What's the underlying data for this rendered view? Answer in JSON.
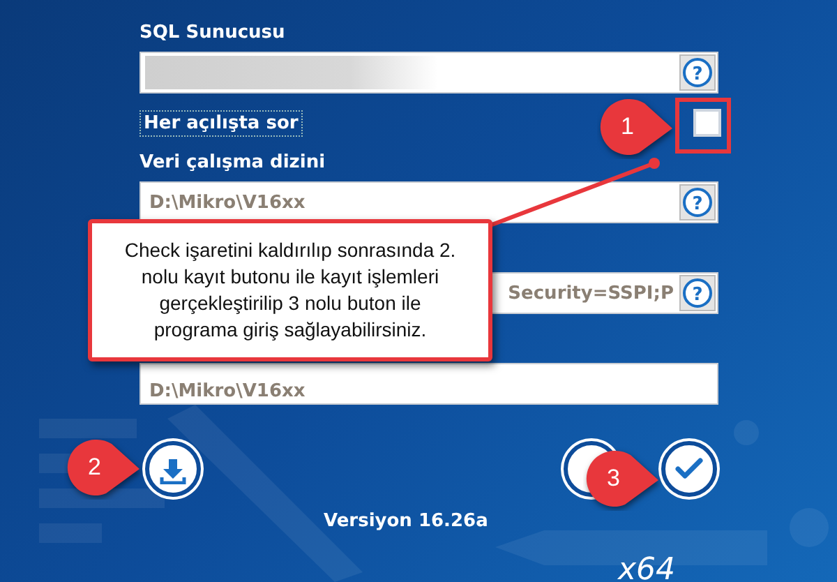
{
  "form": [
    {
      "kind": "label",
      "text": "SQL Sunucusu"
    },
    {
      "kind": "field",
      "masked": true,
      "help": "?"
    },
    {
      "kind": "checkbox",
      "label": "Her açılışta sor",
      "checked": false,
      "focused": true
    },
    {
      "kind": "label",
      "text": "Veri çalışma dizini"
    },
    {
      "kind": "field",
      "value": "D:\\Mikro\\V16xx",
      "help": "?"
    },
    {
      "kind": "field",
      "value": "Security=SSPI;P",
      "help": "?",
      "clipped_start": true
    },
    {
      "kind": "field",
      "value": "D:\\Mikro\\V16xx",
      "clipped_start": true
    }
  ],
  "buttons": [
    {
      "kind": "download"
    },
    {
      "kind": "blank"
    },
    {
      "kind": "confirm"
    }
  ],
  "version": "Versiyon 16.26a",
  "platform": "x64",
  "annotation": {
    "text": "Check işaretini kaldırılıp sonrasında 2. nolu kayıt butonu ile kayıt işlemleri gerçekleştirilip 3 nolu buton ile programa giriş sağlayabilirsiniz.",
    "markers": [
      {
        "number": "1"
      },
      {
        "number": "2"
      },
      {
        "number": "3"
      }
    ]
  }
}
